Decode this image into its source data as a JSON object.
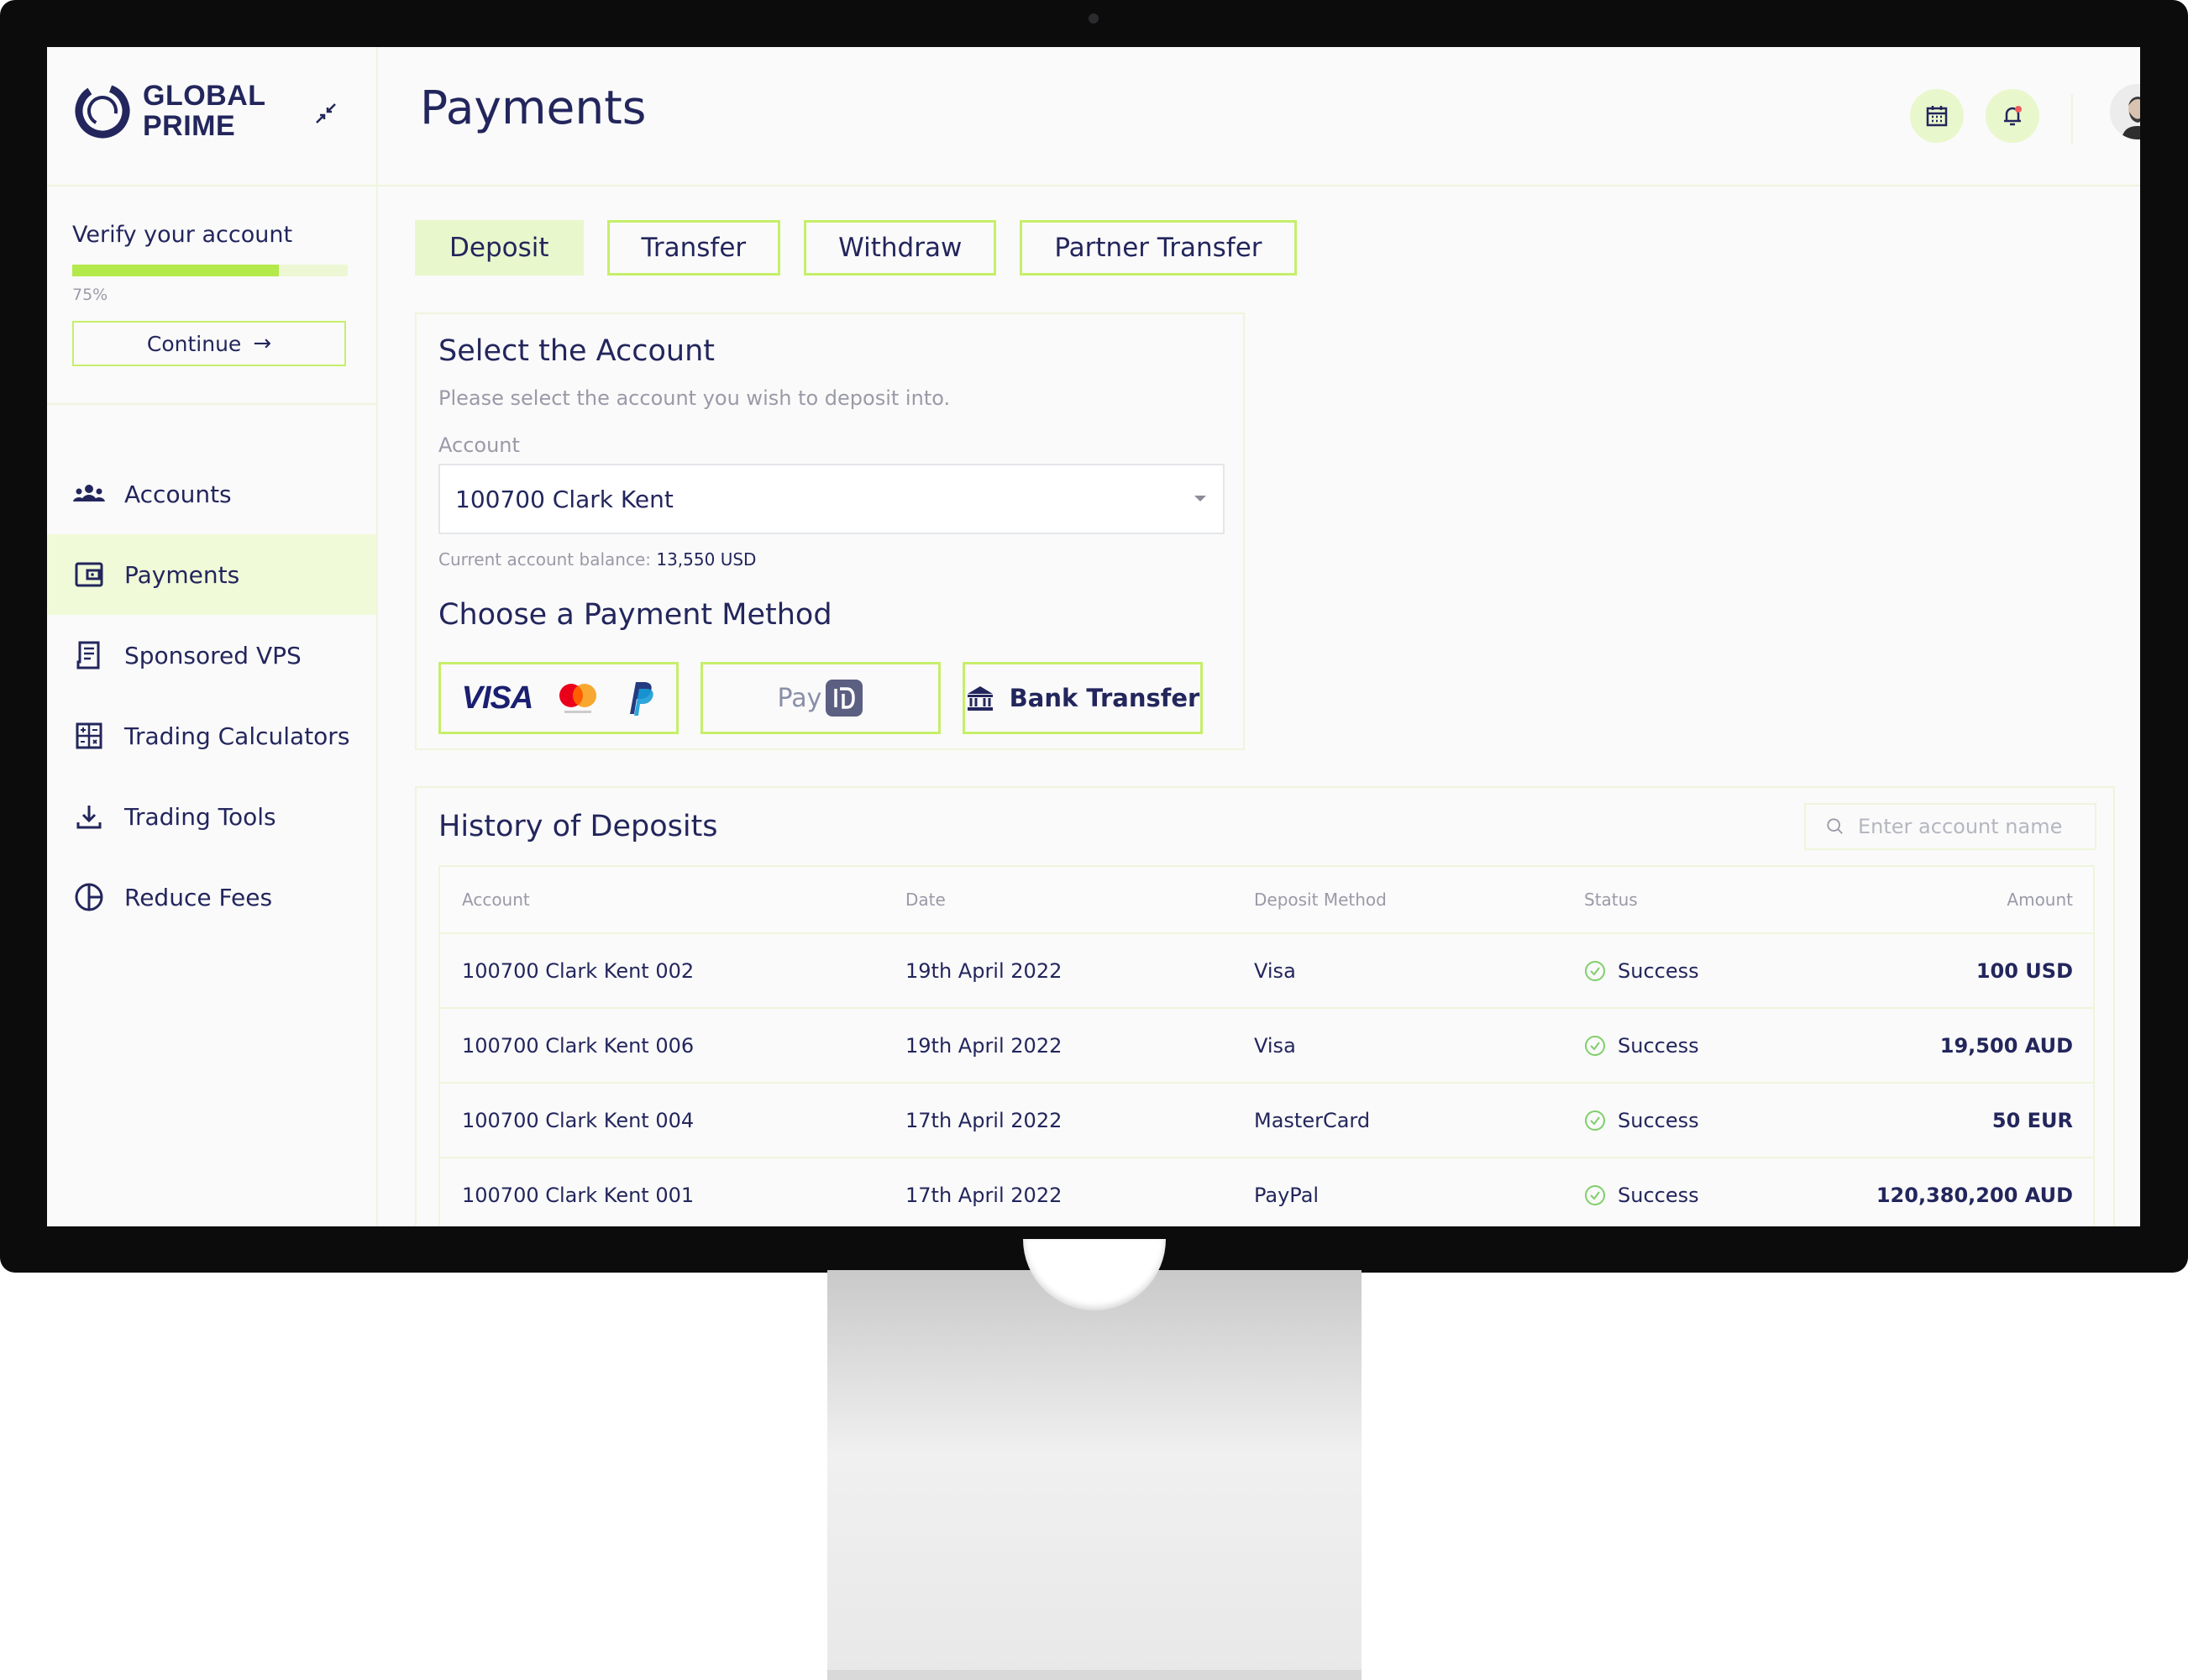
{
  "brand": {
    "name_line1": "GLOBAL",
    "name_line2": "PRIME"
  },
  "sidebar": {
    "verify": {
      "title": "Verify your account",
      "progress": 0.75,
      "progress_text": "75%",
      "continue_label": "Continue"
    },
    "items": [
      {
        "label": "Accounts",
        "icon": "users-icon",
        "active": false
      },
      {
        "label": "Payments",
        "icon": "wallet-icon",
        "active": true
      },
      {
        "label": "Sponsored VPS",
        "icon": "receipt-icon",
        "active": false
      },
      {
        "label": "Trading Calculators",
        "icon": "calculator-icon",
        "active": false
      },
      {
        "label": "Trading Tools",
        "icon": "download-icon",
        "active": false
      },
      {
        "label": "Reduce Fees",
        "icon": "pie-chart-icon",
        "active": false
      }
    ]
  },
  "header": {
    "title": "Payments"
  },
  "tabs": [
    {
      "label": "Deposit",
      "active": true
    },
    {
      "label": "Transfer",
      "active": false
    },
    {
      "label": "Withdraw",
      "active": false
    },
    {
      "label": "Partner Transfer",
      "active": false
    }
  ],
  "select_account": {
    "title": "Select the Account",
    "subtitle": "Please select the account you wish to deposit into.",
    "field_label": "Account",
    "selected": "100700 Clark Kent",
    "balance_label": "Current account balance:",
    "balance_value": "13,550 USD"
  },
  "payment_method": {
    "title": "Choose a Payment Method",
    "options": [
      {
        "label": "VISA",
        "logos": [
          "visa",
          "mastercard",
          "paypal"
        ]
      },
      {
        "label": "Pay",
        "logos": [
          "payid"
        ]
      },
      {
        "label": "Bank Transfer",
        "icon": "bank-icon"
      }
    ]
  },
  "history": {
    "title": "History of Deposits",
    "search_placeholder": "Enter account name",
    "columns": {
      "account": "Account",
      "date": "Date",
      "method": "Deposit Method",
      "status": "Status",
      "amount": "Amount"
    },
    "rows": [
      {
        "account": "100700 Clark Kent  002",
        "date": "19th April 2022",
        "method": "Visa",
        "status": "Success",
        "amount": "100 USD"
      },
      {
        "account": "100700 Clark Kent  006",
        "date": "19th April 2022",
        "method": "Visa",
        "status": "Success",
        "amount": "19,500 AUD"
      },
      {
        "account": "100700 Clark Kent  004",
        "date": "17th April 2022",
        "method": "MasterCard",
        "status": "Success",
        "amount": "50 EUR"
      },
      {
        "account": "100700 Clark Kent  001",
        "date": "17th April 2022",
        "method": "PayPal",
        "status": "Success",
        "amount": "120,380,200 AUD"
      }
    ]
  },
  "colors": {
    "accent": "#b3e94a",
    "accent_light": "#e9f7cc",
    "navy": "#23265c",
    "success": "#7fcf6a"
  }
}
